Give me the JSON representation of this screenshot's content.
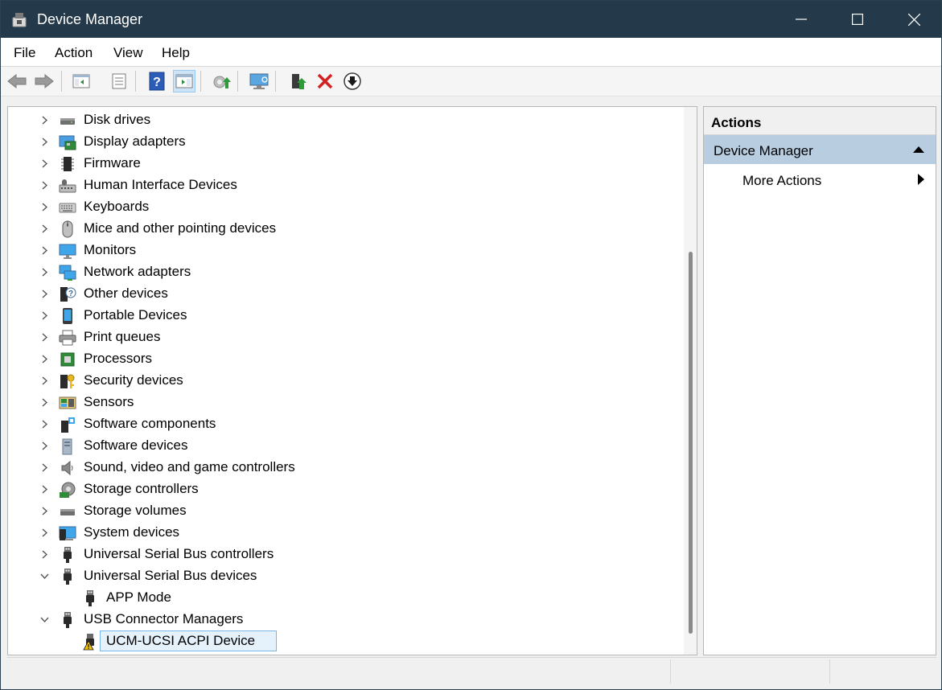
{
  "window": {
    "title": "Device Manager",
    "bg": "#243a4a"
  },
  "menu": [
    "File",
    "Action",
    "View",
    "Help"
  ],
  "tree": [
    {
      "label": "Disk drives",
      "icon": "disk-drive-icon",
      "expander": "collapsed"
    },
    {
      "label": "Display adapters",
      "icon": "display-adapter-icon",
      "expander": "collapsed"
    },
    {
      "label": "Firmware",
      "icon": "firmware-chip-icon",
      "expander": "collapsed"
    },
    {
      "label": "Human Interface Devices",
      "icon": "hid-icon",
      "expander": "collapsed"
    },
    {
      "label": "Keyboards",
      "icon": "keyboard-icon",
      "expander": "collapsed"
    },
    {
      "label": "Mice and other pointing devices",
      "icon": "mouse-icon",
      "expander": "collapsed"
    },
    {
      "label": "Monitors",
      "icon": "monitor-icon",
      "expander": "collapsed"
    },
    {
      "label": "Network adapters",
      "icon": "network-adapter-icon",
      "expander": "collapsed"
    },
    {
      "label": "Other devices",
      "icon": "unknown-device-icon",
      "expander": "collapsed"
    },
    {
      "label": "Portable Devices",
      "icon": "portable-device-icon",
      "expander": "collapsed"
    },
    {
      "label": "Print queues",
      "icon": "printer-icon",
      "expander": "collapsed"
    },
    {
      "label": "Processors",
      "icon": "processor-icon",
      "expander": "collapsed"
    },
    {
      "label": "Security devices",
      "icon": "security-key-icon",
      "expander": "collapsed"
    },
    {
      "label": "Sensors",
      "icon": "sensor-icon",
      "expander": "collapsed"
    },
    {
      "label": "Software components",
      "icon": "software-component-icon",
      "expander": "collapsed"
    },
    {
      "label": "Software devices",
      "icon": "software-device-icon",
      "expander": "collapsed"
    },
    {
      "label": "Sound, video and game controllers",
      "icon": "speaker-icon",
      "expander": "collapsed"
    },
    {
      "label": "Storage controllers",
      "icon": "storage-controller-icon",
      "expander": "collapsed"
    },
    {
      "label": "Storage volumes",
      "icon": "storage-volume-icon",
      "expander": "collapsed"
    },
    {
      "label": "System devices",
      "icon": "system-device-icon",
      "expander": "collapsed"
    },
    {
      "label": "Universal Serial Bus controllers",
      "icon": "usb-plug-icon",
      "expander": "collapsed"
    },
    {
      "label": "Universal Serial Bus devices",
      "icon": "usb-plug-icon",
      "expander": "expanded"
    },
    {
      "label": "APP Mode",
      "icon": "usb-plug-icon",
      "expander": "none",
      "child": true
    },
    {
      "label": "USB Connector Managers",
      "icon": "usb-plug-icon",
      "expander": "expanded"
    },
    {
      "label": "UCM-UCSI ACPI Device",
      "icon": "usb-warning-icon",
      "expander": "none",
      "child": true,
      "selected": true
    }
  ],
  "actions": {
    "header": "Actions",
    "section": "Device Manager",
    "item": "More Actions"
  }
}
